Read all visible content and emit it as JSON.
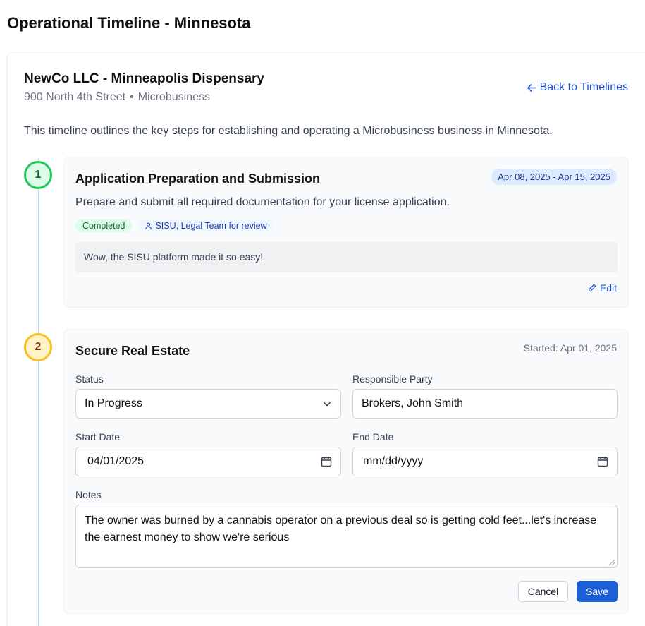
{
  "page": {
    "title": "Operational Timeline - Minnesota"
  },
  "business": {
    "name": "NewCo LLC - Minneapolis Dispensary",
    "address": "900 North 4th Street",
    "separator": "•",
    "type": "Microbusiness",
    "back_label": "Back to Timelines"
  },
  "intro": "This timeline outlines the key steps for establishing and operating a Microbusiness business in Minnesota.",
  "steps": [
    {
      "number": "1",
      "title": "Application Preparation and Submission",
      "date_range": "Apr 08, 2025 - Apr 15, 2025",
      "description": "Prepare and submit all required documentation for your license application.",
      "status_badge": "Completed",
      "responsible": "SISU, Legal Team for review",
      "note": "Wow, the SISU platform made it so easy!",
      "edit_label": "Edit"
    },
    {
      "number": "2",
      "title": "Secure Real Estate",
      "started": "Started: Apr 01, 2025",
      "form": {
        "status_label": "Status",
        "status_value": "In Progress",
        "responsible_label": "Responsible Party",
        "responsible_value": "Brokers, John Smith",
        "start_label": "Start Date",
        "start_value": "04/01/2025",
        "end_label": "End Date",
        "end_placeholder": "mm/dd/yyyy",
        "notes_label": "Notes",
        "notes_value": "The owner was burned by a cannabis operator on a previous deal so is getting cold feet...let's increase the earnest money to show we're serious",
        "cancel_label": "Cancel",
        "save_label": "Save"
      }
    }
  ],
  "colors": {
    "accent": "#1d4ed8",
    "completed": "#22c55e",
    "in_progress": "#fbbf24"
  }
}
